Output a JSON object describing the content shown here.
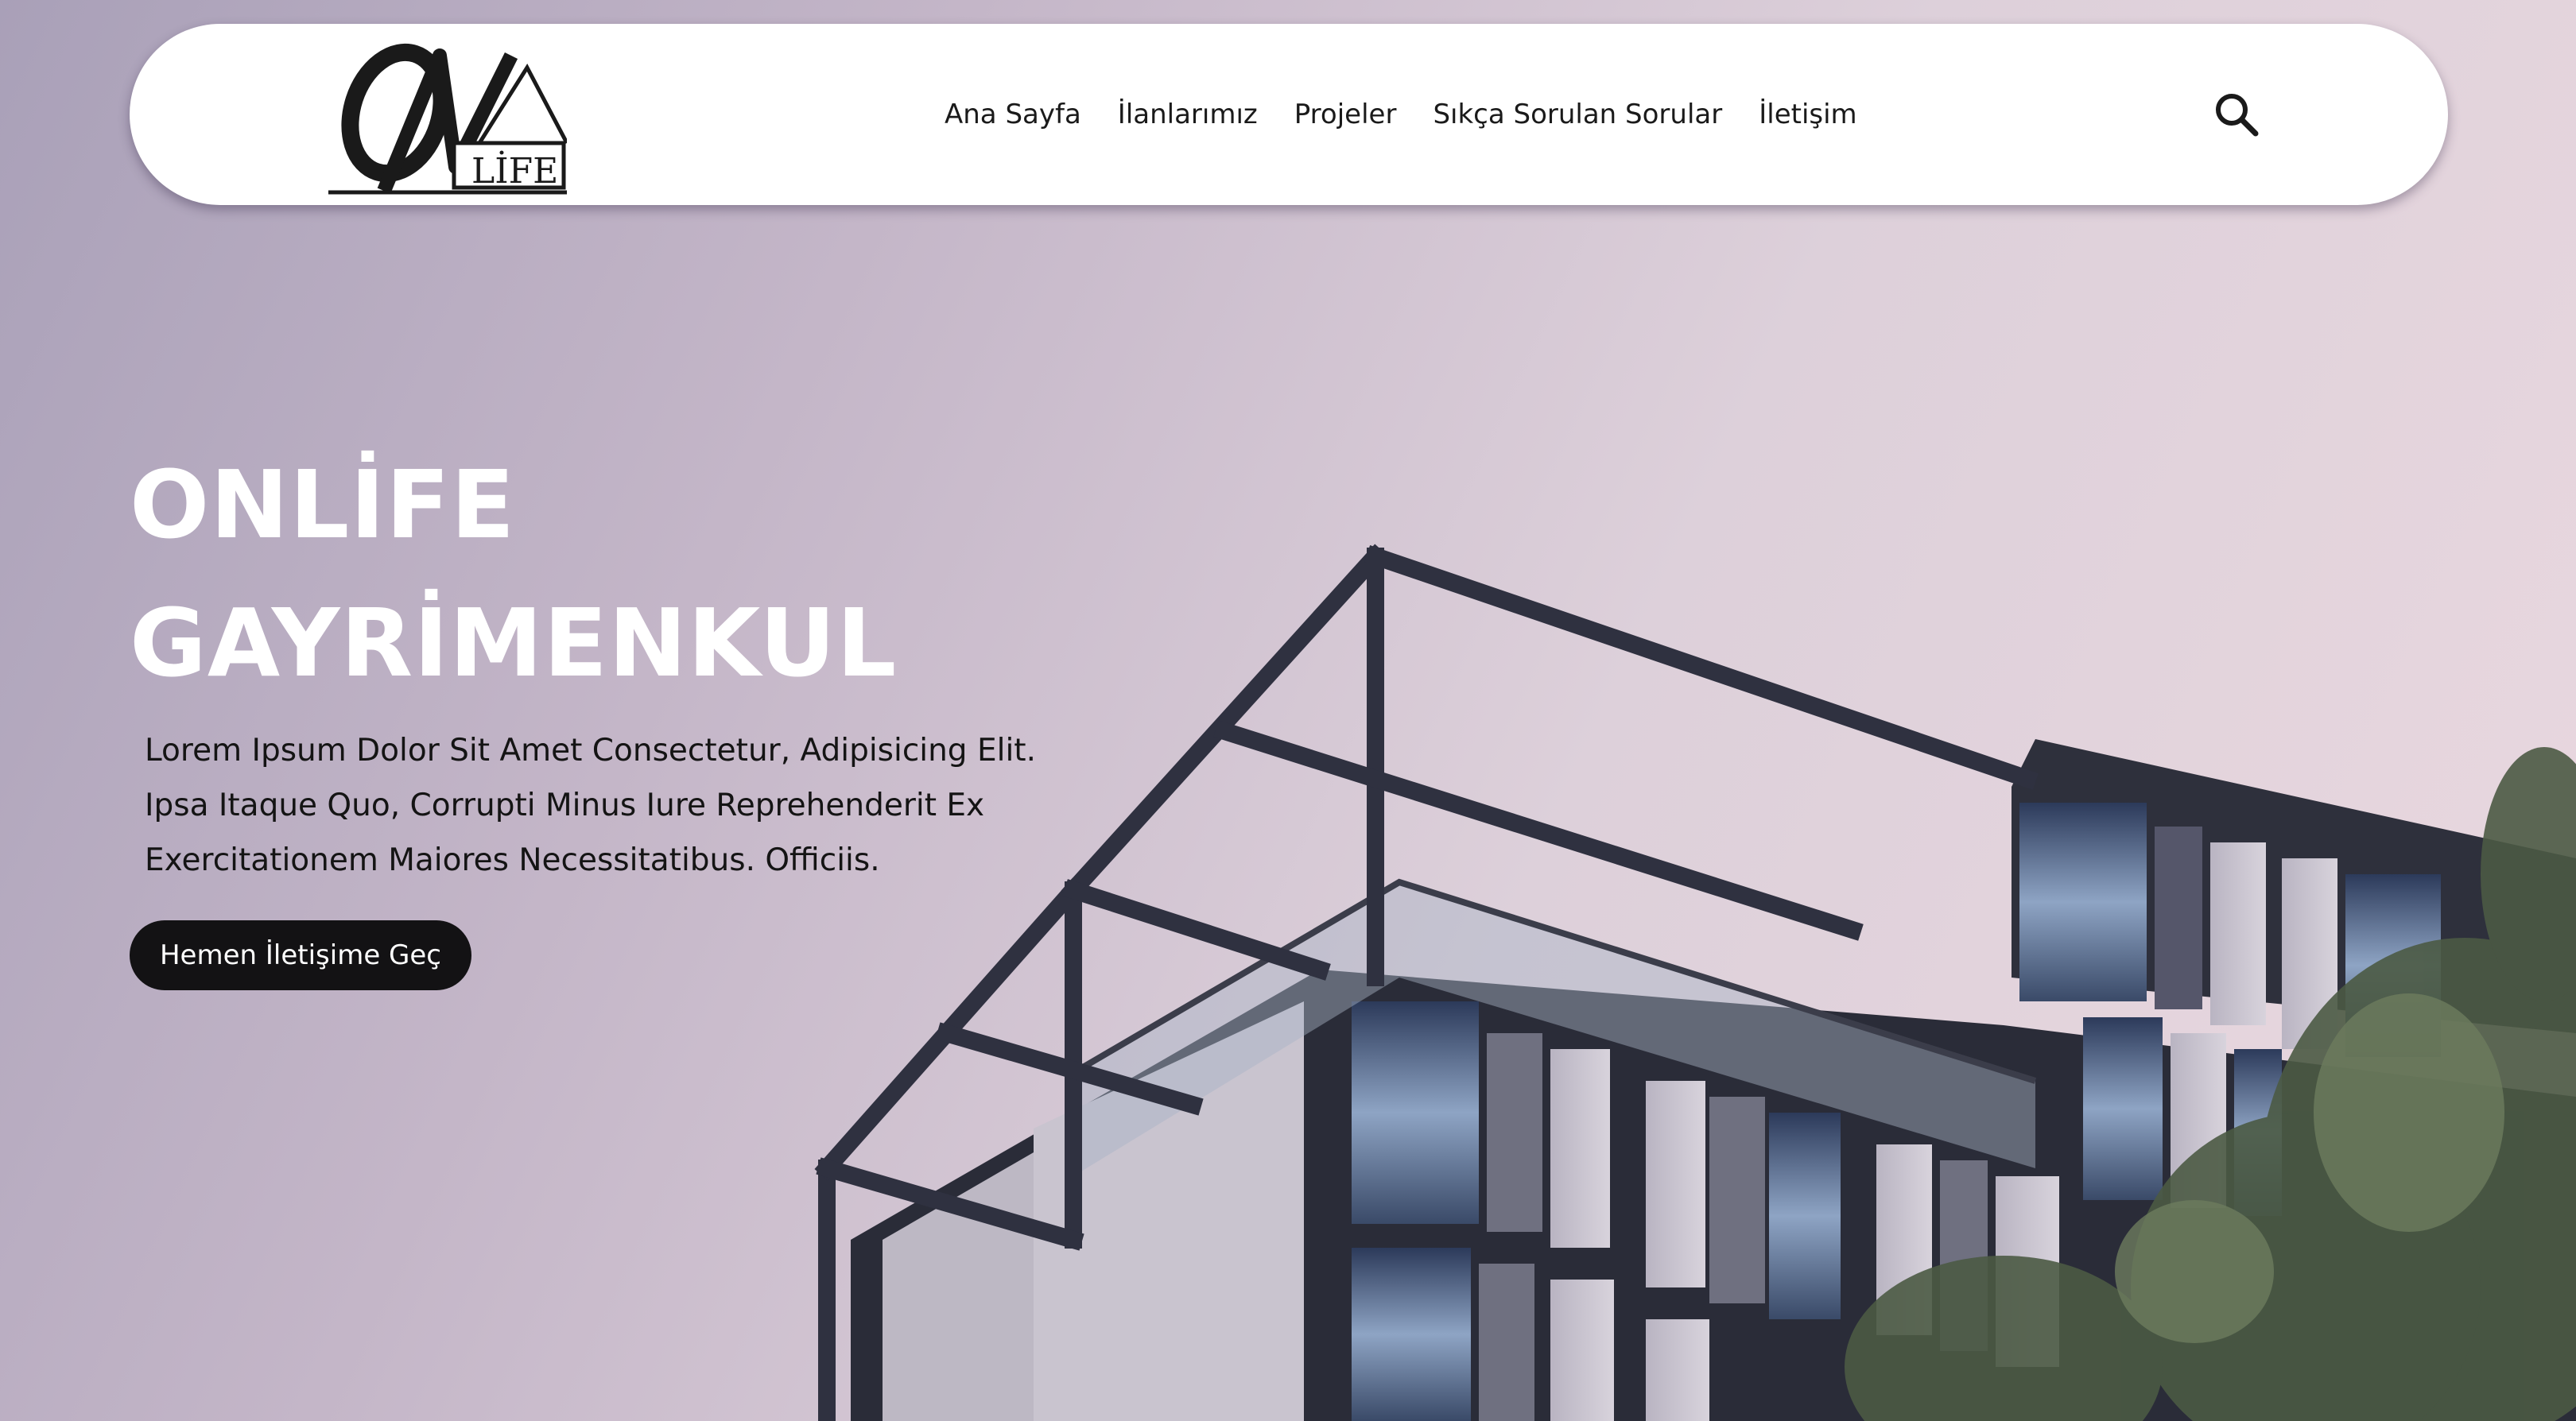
{
  "header": {
    "logo_text": "LİFE",
    "nav": [
      {
        "label": "Ana Sayfa"
      },
      {
        "label": "İlanlarımız"
      },
      {
        "label": "Projeler"
      },
      {
        "label": "Sıkça Sorulan Sorular"
      },
      {
        "label": "İletişim"
      }
    ],
    "search_icon": "search-icon"
  },
  "hero": {
    "title_line1": "ONLİFE",
    "title_line2": "GAYRİMENKUL",
    "description": "Lorem Ipsum Dolor Sit Amet Consectetur, Adipisicing Elit. Ipsa Itaque Quo, Corrupti Minus Iure Reprehenderit Ex Exercitationem Maiores Necessitatibus. Officiis.",
    "cta_label": "Hemen İletişime Geç"
  },
  "colors": {
    "header_bg": "#ffffff",
    "cta_bg": "#131214",
    "hero_title": "#ffffff",
    "frame": "#2f3140"
  }
}
